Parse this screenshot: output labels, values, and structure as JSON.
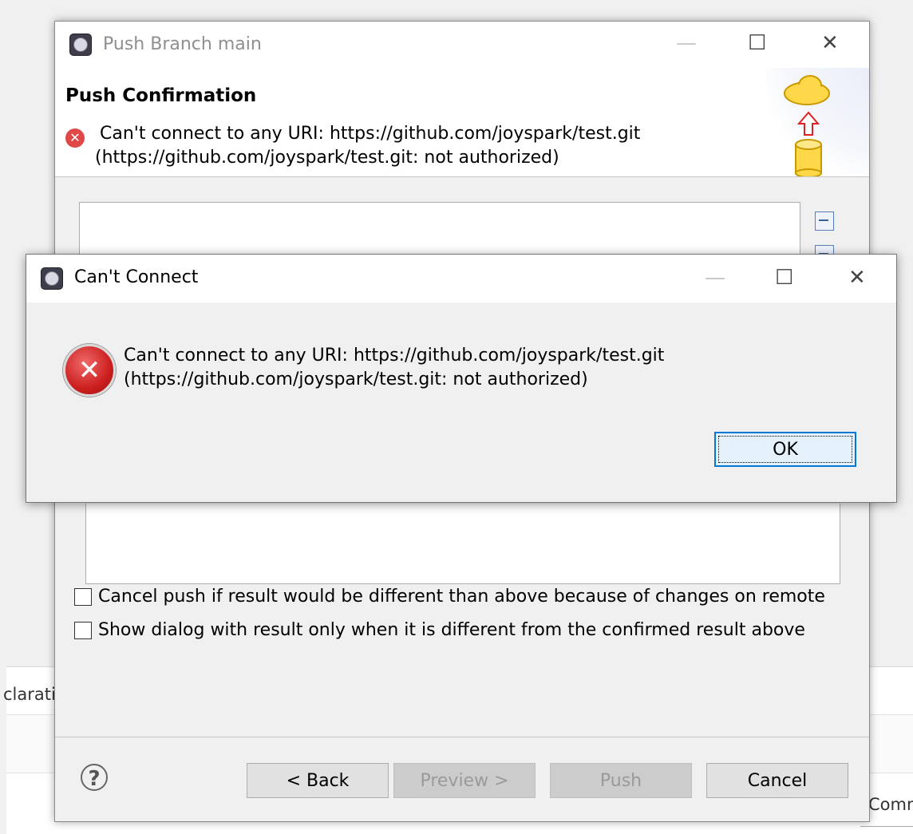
{
  "background": {
    "left_text": "clarati",
    "right_text": "Comn"
  },
  "push_dialog": {
    "title": "Push Branch main",
    "heading": "Push Confirmation",
    "error_line1": "Can't connect to any URI: https://github.com/joyspark/test.git",
    "error_line2": "(https://github.com/joyspark/test.git: not authorized)",
    "checkbox_cancel_push": "Cancel push if result would be different than above because of changes on remote",
    "checkbox_show_dialog": "Show dialog with result only when it is different from the confirmed result above",
    "buttons": {
      "back": "< Back",
      "preview": "Preview >",
      "push": "Push",
      "cancel": "Cancel"
    },
    "help_glyph": "?"
  },
  "error_dialog": {
    "title": "Can't Connect",
    "message_line1": "Can't connect to any URI: https://github.com/joyspark/test.git",
    "message_line2": "(https://github.com/joyspark/test.git: not authorized)",
    "ok_label": "OK"
  },
  "window_controls": {
    "minimize": "—",
    "maximize": "☐",
    "close": "✕"
  },
  "colors": {
    "error_red": "#cc1f1f",
    "focus_blue": "#0078d7",
    "disabled_text": "#9a9a9a"
  }
}
